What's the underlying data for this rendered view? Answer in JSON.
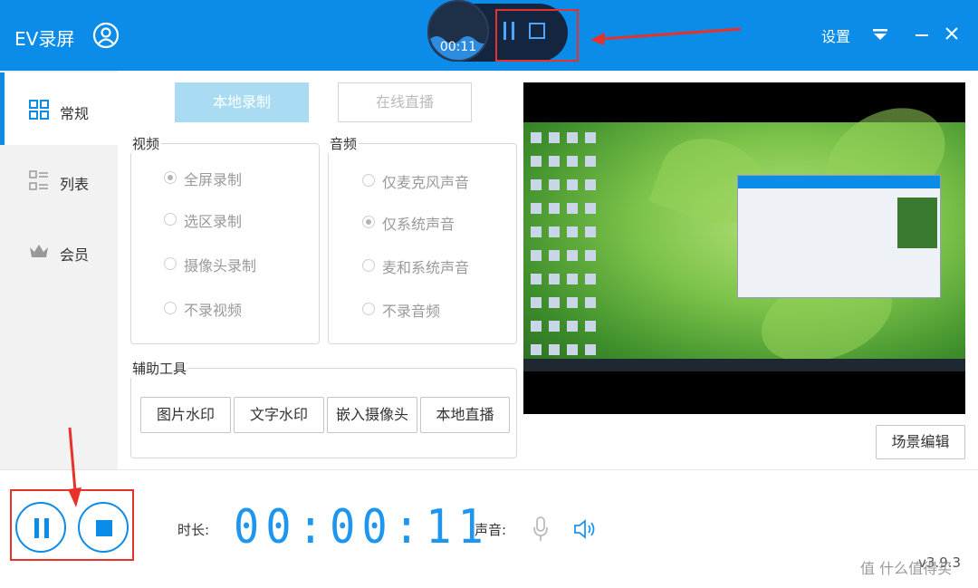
{
  "header": {
    "title": "EV录屏",
    "settings_label": "设置"
  },
  "widget": {
    "time": "00:11"
  },
  "sidebar": {
    "items": [
      {
        "label": "常规",
        "icon": "grid-icon"
      },
      {
        "label": "列表",
        "icon": "list-icon"
      },
      {
        "label": "会员",
        "icon": "crown-icon"
      }
    ]
  },
  "tabs": {
    "local_record": "本地录制",
    "online_live": "在线直播"
  },
  "video": {
    "title": "视频",
    "options": [
      "全屏录制",
      "选区录制",
      "摄像头录制",
      "不录视频"
    ],
    "selected": "全屏录制"
  },
  "audio": {
    "title": "音频",
    "options": [
      "仅麦克风声音",
      "仅系统声音",
      "麦和系统声音",
      "不录音频"
    ],
    "selected": "仅系统声音"
  },
  "tools": {
    "title": "辅助工具",
    "buttons": [
      "图片水印",
      "文字水印",
      "嵌入摄像头",
      "本地直播"
    ]
  },
  "scene_edit": "场景编辑",
  "bottom": {
    "duration_label": "时长:",
    "timer": "00:00:11",
    "sound_label": "声音:",
    "version": "v3.9.3",
    "watermark": "值 什么值得买"
  },
  "colors": {
    "accent": "#0a8ce8",
    "highlight": "#e8312a",
    "timer": "#1e96f0"
  }
}
